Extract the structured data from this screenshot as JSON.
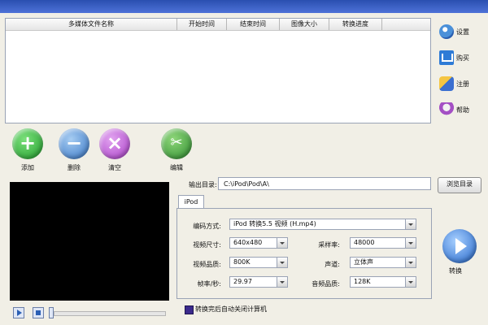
{
  "window": {
    "title": ""
  },
  "file_list": {
    "columns": [
      "多媒体文件名称",
      "开始时间",
      "结束时间",
      "图像大小",
      "转换进度"
    ],
    "rows": []
  },
  "side_menu": [
    {
      "label": "设置",
      "icon": "gear-icon"
    },
    {
      "label": "购买",
      "icon": "cart-icon"
    },
    {
      "label": "注册",
      "icon": "key-icon"
    },
    {
      "label": "帮助",
      "icon": "help-icon"
    }
  ],
  "toolbar": {
    "add": "添加",
    "delete": "删除",
    "clear": "清空",
    "edit": "编辑"
  },
  "output": {
    "label": "输出目录:",
    "path": "C:\\iPod\\Pod\\A\\",
    "browse": "浏览目录"
  },
  "tab": {
    "label": "iPod"
  },
  "settings": {
    "format_label": "编码方式:",
    "format_value": "iPod 转换5.5 视频 (H.mp4)",
    "video_size_label": "视频尺寸:",
    "video_size_value": "640x480",
    "video_quality_label": "视频品质:",
    "video_quality_value": "800K",
    "fps_label": "帧率/秒:",
    "fps_value": "29.97",
    "sample_rate_label": "采样率:",
    "sample_rate_value": "48000",
    "channel_label": "声道:",
    "channel_value": "立体声",
    "audio_quality_label": "音频品质:",
    "audio_quality_value": "128K"
  },
  "checkbox": {
    "label": "转换完后自动关闭计算机"
  },
  "convert": {
    "label": "转换"
  },
  "colors": {
    "accent": "#1f62c7",
    "preview_bg": "#000000"
  }
}
